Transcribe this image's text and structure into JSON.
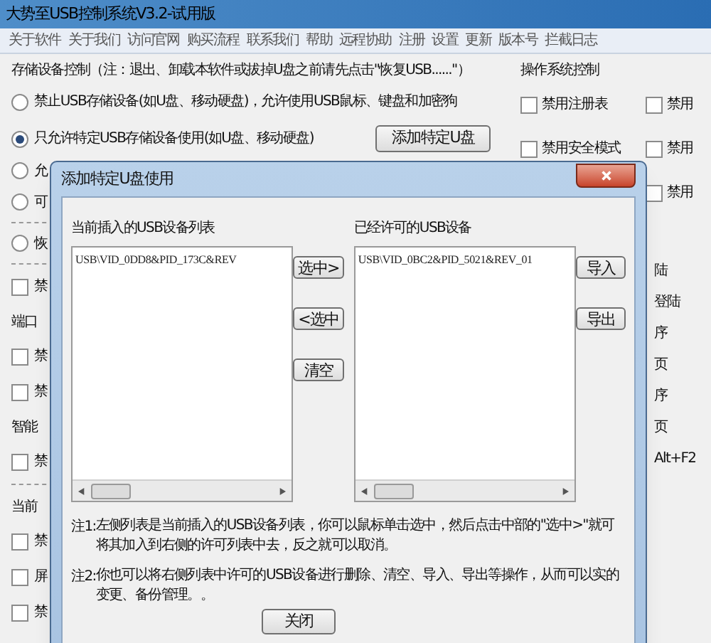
{
  "window": {
    "title": "大势至USB控制系统V3.2-试用版"
  },
  "menu": [
    "关于软件",
    "关于我们",
    "访问官网",
    "购买流程",
    "联系我们",
    "帮助",
    "远程协助",
    "注册",
    "设置",
    "更新",
    "版本号",
    "拦截日志"
  ],
  "storage": {
    "title": "存储设备控制（注：退出、卸载本软件或拔掉U盘之前请先点击\"恢复USB......\"）",
    "options": [
      {
        "label": "禁止USB存储设备(如U盘、移动硬盘)，允许使用USB鼠标、键盘和加密狗",
        "selected": false
      },
      {
        "label": "只允许特定USB存储设备使用(如U盘、移动硬盘)",
        "selected": true
      }
    ],
    "add_button": "添加特定U盘"
  },
  "left_items": [
    {
      "kind": "radio",
      "label": "允",
      "selected": false
    },
    {
      "kind": "radio",
      "label": "可",
      "selected": false
    },
    {
      "kind": "dashes"
    },
    {
      "kind": "radio",
      "label": "恢",
      "selected": false
    },
    {
      "kind": "dashes"
    },
    {
      "kind": "checkbox",
      "label": "禁",
      "checked": false
    },
    {
      "kind": "heading",
      "label": "端口"
    },
    {
      "kind": "checkbox",
      "label": "禁",
      "checked": false
    },
    {
      "kind": "checkbox",
      "label": "禁",
      "checked": false
    },
    {
      "kind": "heading",
      "label": "智能"
    },
    {
      "kind": "checkbox",
      "label": "禁",
      "checked": false
    },
    {
      "kind": "dashes"
    },
    {
      "kind": "heading",
      "label": "当前"
    },
    {
      "kind": "checkbox",
      "label": "禁",
      "checked": false
    },
    {
      "kind": "checkbox",
      "label": "屏",
      "checked": false
    },
    {
      "kind": "checkbox",
      "label": "禁",
      "checked": false
    }
  ],
  "os": {
    "title": "操作系统控制",
    "items": [
      {
        "label": "禁用注册表",
        "checked": false
      },
      {
        "label": "禁用",
        "checked": false
      },
      {
        "label": "禁用安全模式",
        "checked": false
      },
      {
        "label": "禁用",
        "checked": false
      },
      {
        "label": "禁用",
        "checked": false
      }
    ]
  },
  "right_fragments": [
    "陆",
    "登陆",
    "序",
    "页",
    "序",
    "页",
    "Alt+F2"
  ],
  "dialog": {
    "title": "添加特定U盘使用",
    "left_list": {
      "label": "当前插入的USB设备列表",
      "items": [
        "USB\\VID_0DD8&PID_173C&REV"
      ]
    },
    "right_list": {
      "label": "已经许可的USB设备",
      "items": [
        "USB\\VID_0BC2&PID_5021&REV_01"
      ]
    },
    "middle_buttons": [
      "选中>",
      "<选中",
      "清空"
    ],
    "side_buttons": [
      "导入",
      "导出"
    ],
    "notes": [
      {
        "label": "注1:",
        "text": "左侧列表是当前插入的USB设备列表，你可以鼠标单击选中，然后点击中部的\"选中>\"就可将其加入到右侧的许可列表中去，反之就可以取消。"
      },
      {
        "label": "注2:",
        "text": "你也可以将右侧列表中许可的USB设备进行删除、清空、导入、导出等操作，从而可以实的变更、备份管理。。"
      }
    ],
    "close_button": "关闭"
  }
}
